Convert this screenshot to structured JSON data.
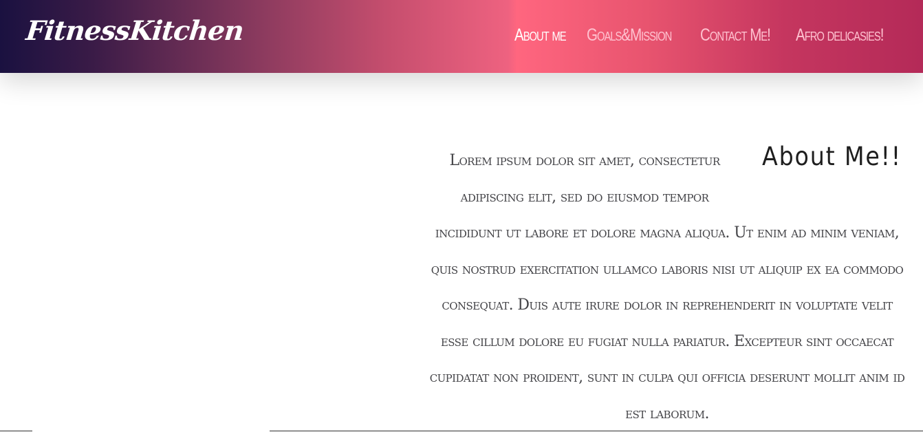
{
  "navbar": {
    "brand": "FitnessKitchen",
    "links": [
      {
        "label": "About me",
        "active": true
      },
      {
        "label": "Goals&Mission",
        "active": false
      },
      {
        "label": "Contact Me!",
        "active": false
      },
      {
        "label": "Afro delicasies!",
        "active": false
      }
    ]
  },
  "about": {
    "heading": "About Me!!",
    "body": "Lorem ipsum dolor sit amet, consectetur adipiscing elit, sed do eiusmod tempor incididunt ut labore et dolore magna aliqua. Ut enim ad minim veniam, quis nostrud exercitation ullamco laboris nisi ut aliquip ex ea commodo consequat. Duis aute irure dolor in reprehenderit in voluptate velit esse cillum dolore eu fugiat nulla pariatur. Excepteur sint occaecat cupidatat non proident, sunt in culpa qui officia deserunt mollit anim id est laborum."
  },
  "colors": {
    "gradient_start": "#1a1140",
    "gradient_peak": "#ff667f",
    "gradient_end": "#b42a58",
    "nav_active": "#ffffff",
    "nav_inactive": "#ffc2d0",
    "body_text": "#444448"
  }
}
